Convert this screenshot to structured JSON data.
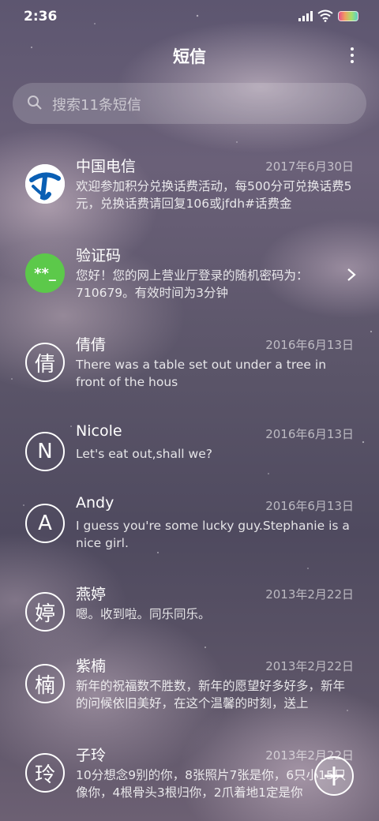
{
  "status": {
    "time": "2:36"
  },
  "header": {
    "title": "短信"
  },
  "search": {
    "placeholder": "搜索11条短信"
  },
  "conversations": [
    {
      "name": "中国电信",
      "date": "2017年6月30日",
      "preview": "欢迎参加积分兑换话费活动，每500分可兑换话费5元，兑换话费请回复106或jfdh#话费金",
      "avatar": "china-telecom-logo-icon"
    },
    {
      "name": "验证码",
      "date": "",
      "preview": "您好！您的网上营业厅登录的随机密码为：710679。有效时间为3分钟",
      "avatar_text": "**_"
    },
    {
      "name": "倩倩",
      "date": "2016年6月13日",
      "preview": "There was a table set out under a tree in front of the hous",
      "avatar_text": "倩"
    },
    {
      "name": "Nicole",
      "date": "2016年6月13日",
      "preview": "Let's eat out,shall we?",
      "avatar_text": "N"
    },
    {
      "name": "Andy",
      "date": "2016年6月13日",
      "preview": "I guess you're some lucky guy.Stephanie is a nice girl.",
      "avatar_text": "A"
    },
    {
      "name": "燕婷",
      "date": "2013年2月22日",
      "preview": "嗯。收到啦。同乐同乐。",
      "avatar_text": "婷"
    },
    {
      "name": "紫楠",
      "date": "2013年2月22日",
      "preview": "新年的祝福数不胜数，新年的愿望好多好多，新年的问候依旧美好，在这个温馨的时刻，送上",
      "avatar_text": "楠"
    },
    {
      "name": "子玲",
      "date": "2013年2月22日",
      "preview": "10分想念9别的你，8张照片7张是你，6只小15只像你，4根骨头3根归你，2爪着地1定是你",
      "avatar_text": "玲"
    }
  ],
  "colors": {
    "verify_avatar": "#5cc94a",
    "telecom_blue": "#0a5fb4"
  }
}
